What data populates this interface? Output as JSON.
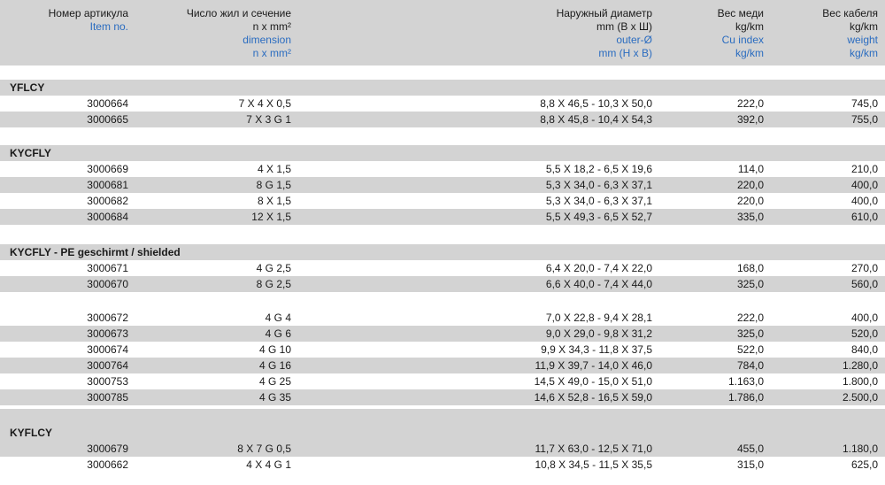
{
  "header": {
    "item_no_ru": "Номер артикула",
    "item_no_en": "Item no.",
    "dimension_ru_1": "Число жил и сечение",
    "dimension_ru_2": "n x mm²",
    "dimension_en_1": "dimension",
    "dimension_en_2": "n x mm²",
    "diameter_ru_1": "Наружный диаметр",
    "diameter_ru_2": "mm (В х Ш)",
    "diameter_en_1": "outer-Ø",
    "diameter_en_2": "mm (H x B)",
    "cu_ru_1": "Вес меди",
    "cu_ru_2": "kg/km",
    "cu_en_1": "Cu index",
    "cu_en_2": "kg/km",
    "weight_ru_1": "Вес кабеля",
    "weight_ru_2": "kg/km",
    "weight_en_1": "weight",
    "weight_en_2": "kg/km"
  },
  "groups": [
    {
      "label": "YFLCY",
      "rows": [
        {
          "item": "3000664",
          "dim": "7 X 4 X 0,5",
          "diameter": "8,8 X 46,5 - 10,3 X 50,0",
          "cu": "222,0",
          "weight": "745,0"
        },
        {
          "item": "3000665",
          "dim": "7 X 3 G 1",
          "diameter": "8,8 X 45,8 - 10,4 X 54,3",
          "cu": "392,0",
          "weight": "755,0"
        }
      ]
    },
    {
      "label": "KYCFLY",
      "rows": [
        {
          "item": "3000669",
          "dim": "4 X 1,5",
          "diameter": "5,5 X 18,2 - 6,5 X 19,6",
          "cu": "114,0",
          "weight": "210,0"
        },
        {
          "item": "3000681",
          "dim": "8 G 1,5",
          "diameter": "5,3 X 34,0 - 6,3 X 37,1",
          "cu": "220,0",
          "weight": "400,0"
        },
        {
          "item": "3000682",
          "dim": "8 X 1,5",
          "diameter": "5,3 X 34,0 - 6,3 X 37,1",
          "cu": "220,0",
          "weight": "400,0"
        },
        {
          "item": "3000684",
          "dim": "12 X 1,5",
          "diameter": "5,5 X 49,3 - 6,5 X 52,7",
          "cu": "335,0",
          "weight": "610,0"
        }
      ]
    },
    {
      "label": "KYCFLY - PE geschirmt / shielded",
      "rows": [
        {
          "item": "3000671",
          "dim": "4 G 2,5",
          "diameter": "6,4 X 20,0 - 7,4 X 22,0",
          "cu": "168,0",
          "weight": "270,0"
        },
        {
          "item": "3000670",
          "dim": "8 G 2,5",
          "diameter": "6,6 X 40,0 - 7,4 X 44,0",
          "cu": "325,0",
          "weight": "560,0"
        }
      ]
    },
    {
      "label": "",
      "rows": [
        {
          "item": "3000672",
          "dim": "4 G 4",
          "diameter": "7,0 X 22,8 - 9,4 X 28,1",
          "cu": "222,0",
          "weight": "400,0"
        },
        {
          "item": "3000673",
          "dim": "4 G 6",
          "diameter": "9,0 X 29,0 - 9,8 X 31,2",
          "cu": "325,0",
          "weight": "520,0"
        },
        {
          "item": "3000674",
          "dim": "4 G 10",
          "diameter": "9,9 X 34,3 - 11,8 X 37,5",
          "cu": "522,0",
          "weight": "840,0"
        },
        {
          "item": "3000764",
          "dim": "4 G 16",
          "diameter": "11,9 X 39,7 - 14,0 X 46,0",
          "cu": "784,0",
          "weight": "1.280,0"
        },
        {
          "item": "3000753",
          "dim": "4 G 25",
          "diameter": "14,5 X 49,0 - 15,0 X 51,0",
          "cu": "1.163,0",
          "weight": "1.800,0"
        },
        {
          "item": "3000785",
          "dim": "4 G 35",
          "diameter": "14,6 X 52,8 - 16,5 X 59,0",
          "cu": "1.786,0",
          "weight": "2.500,0"
        }
      ]
    },
    {
      "label": "KYFLCY",
      "rows": [
        {
          "item": "3000679",
          "dim": "8 X 7 G 0,5",
          "diameter": "11,7 X 63,0 - 12,5 X 71,0",
          "cu": "455,0",
          "weight": "1.180,0"
        },
        {
          "item": "3000662",
          "dim": "4 X 4 G 1",
          "diameter": "10,8 X 34,5 - 11,5 X 35,5",
          "cu": "315,0",
          "weight": "625,0"
        }
      ]
    }
  ]
}
